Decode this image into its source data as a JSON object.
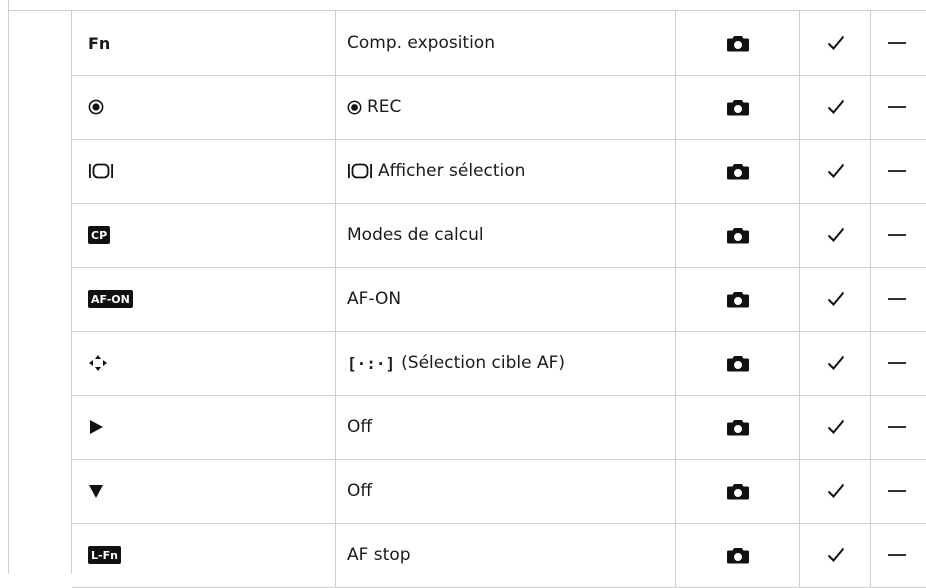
{
  "rows": [
    {
      "control": {
        "type": "text",
        "text": "Fn"
      },
      "control_icon": "fn-text",
      "function": "Comp. exposition",
      "function_prefix": null
    },
    {
      "control": {
        "type": "icon"
      },
      "control_icon": "record-button-icon",
      "function": "REC",
      "function_prefix": "record-icon"
    },
    {
      "control": {
        "type": "icon"
      },
      "control_icon": "display-select-icon",
      "function": "Afficher sélection",
      "function_prefix": "display-select-icon"
    },
    {
      "control": {
        "type": "badge",
        "text": "CP"
      },
      "control_icon": "cp-badge",
      "function": "Modes de calcul",
      "function_prefix": null
    },
    {
      "control": {
        "type": "badge",
        "text": "AF-ON"
      },
      "control_icon": "af-on-badge",
      "function": "AF-ON",
      "function_prefix": null
    },
    {
      "control": {
        "type": "icon"
      },
      "control_icon": "multi-selector-icon",
      "function": "(Sélection cible AF)",
      "function_prefix": "af-target-icon"
    },
    {
      "control": {
        "type": "icon"
      },
      "control_icon": "arrow-right-icon",
      "function": "Off",
      "function_prefix": null
    },
    {
      "control": {
        "type": "icon"
      },
      "control_icon": "arrow-down-icon",
      "function": "Off",
      "function_prefix": null
    },
    {
      "control": {
        "type": "badge",
        "text": "L-Fn"
      },
      "control_icon": "l-fn-badge",
      "function": "AF stop",
      "function_prefix": null
    }
  ],
  "af_target_brackets": "[·:·]",
  "still_mode_icon": "camera-icon",
  "checked_icon": "checkmark-icon",
  "disabled_icon": "dash-icon",
  "colors": {
    "border": "#cfcfcf",
    "ink": "#1a1a1a",
    "badge_bg": "#111111"
  }
}
